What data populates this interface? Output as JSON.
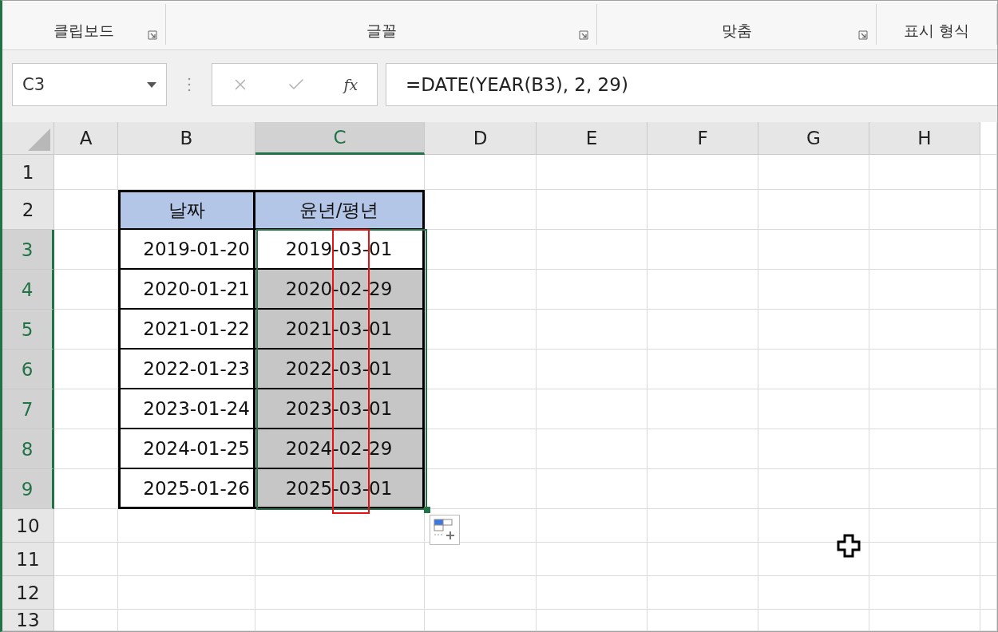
{
  "ribbon": {
    "groups": [
      {
        "label": "클립보드",
        "launcher": true
      },
      {
        "label": "글꼴",
        "launcher": true
      },
      {
        "label": "맞춤",
        "launcher": true
      },
      {
        "label": "표시 형식",
        "launcher": false
      }
    ]
  },
  "formula_bar": {
    "name_box": "C3",
    "function_label": "fx",
    "formula": "=DATE(YEAR(B3), 2, 29)"
  },
  "sheet": {
    "columns": [
      {
        "label": "A",
        "selected": false
      },
      {
        "label": "B",
        "selected": false
      },
      {
        "label": "C",
        "selected": true
      },
      {
        "label": "D",
        "selected": false
      },
      {
        "label": "E",
        "selected": false
      },
      {
        "label": "F",
        "selected": false
      },
      {
        "label": "G",
        "selected": false
      },
      {
        "label": "H",
        "selected": false
      }
    ],
    "rows": [
      {
        "label": "1",
        "selected": false,
        "kind": "blank"
      },
      {
        "label": "2",
        "selected": false,
        "kind": "header",
        "date": "날짜",
        "result": "윤년/평년"
      },
      {
        "label": "3",
        "selected": true,
        "kind": "data",
        "date": "2019-01-20",
        "result": "2019-03-01",
        "highlighted": false
      },
      {
        "label": "4",
        "selected": true,
        "kind": "data",
        "date": "2020-01-21",
        "result": "2020-02-29",
        "highlighted": true
      },
      {
        "label": "5",
        "selected": true,
        "kind": "data",
        "date": "2021-01-22",
        "result": "2021-03-01",
        "highlighted": true
      },
      {
        "label": "6",
        "selected": true,
        "kind": "data",
        "date": "2022-01-23",
        "result": "2022-03-01",
        "highlighted": true
      },
      {
        "label": "7",
        "selected": true,
        "kind": "data",
        "date": "2023-01-24",
        "result": "2023-03-01",
        "highlighted": true
      },
      {
        "label": "8",
        "selected": true,
        "kind": "data",
        "date": "2024-01-25",
        "result": "2024-02-29",
        "highlighted": true
      },
      {
        "label": "9",
        "selected": true,
        "kind": "data",
        "date": "2025-01-26",
        "result": "2025-03-01",
        "highlighted": true
      },
      {
        "label": "10",
        "selected": false,
        "kind": "blank"
      },
      {
        "label": "11",
        "selected": false,
        "kind": "blank"
      },
      {
        "label": "12",
        "selected": false,
        "kind": "blank"
      },
      {
        "label": "13",
        "selected": false,
        "kind": "blank"
      }
    ]
  }
}
